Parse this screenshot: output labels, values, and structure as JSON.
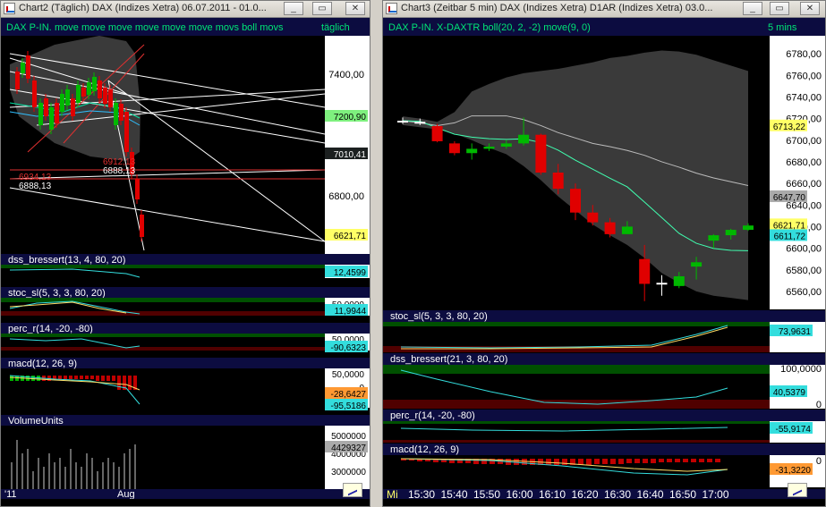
{
  "left_window": {
    "title": "Chart2 (Täglich)  DAX (Indizes Xetra) 06.07.2011 - 01.0...",
    "buttons": [
      "_",
      "▭",
      "✕"
    ],
    "header_label": "DAX P-IN.",
    "header_indicators": "move move move move move move movs boll movs",
    "interval": "täglich",
    "x_labels": [
      "'11",
      "Aug"
    ],
    "panels": [
      {
        "id": "main",
        "ticks": [
          "7400,00",
          "6800,00"
        ],
        "badges": [
          {
            "text": "7200,90",
            "style": "green"
          },
          {
            "text": "7010,41",
            "style": "dark"
          },
          {
            "text": "6621,71",
            "style": "yellow"
          }
        ],
        "annotations": [
          "6934,13",
          "6888,13",
          "6888,13",
          "6912,13"
        ]
      },
      {
        "id": "dss",
        "label": "dss_bressert(13, 4, 80, 20)",
        "ticks": [],
        "badges": [
          {
            "text": "12,4599",
            "style": "cyan"
          }
        ]
      },
      {
        "id": "stoc",
        "label": "stoc_sl(5, 3, 3, 80, 20)",
        "ticks": [
          "50,0000"
        ],
        "badges": [
          {
            "text": "11,9944",
            "style": "cyan"
          }
        ]
      },
      {
        "id": "percr",
        "label": "perc_r(14, -20, -80)",
        "ticks": [
          "50,0000"
        ],
        "badges": [
          {
            "text": "-90,6323",
            "style": "cyan"
          }
        ]
      },
      {
        "id": "macd",
        "label": "macd(12, 26, 9)",
        "ticks": [
          "50,0000",
          "0"
        ],
        "badges": [
          {
            "text": "-28,6427",
            "style": "orange"
          },
          {
            "text": "-95,5186",
            "style": "cyan"
          }
        ]
      },
      {
        "id": "volume",
        "label": "VolumeUnits",
        "ticks": [
          "5000000",
          "4000000",
          "3000000"
        ],
        "badges": [
          {
            "text": "4429327",
            "style": "gray"
          }
        ]
      }
    ]
  },
  "right_window": {
    "title": "Chart3 (Zeitbar 5 min)  DAX (Indizes Xetra) D1AR (Indizes Xetra) 03.0...",
    "buttons": [
      "_",
      "▭",
      "✕"
    ],
    "header_label": "DAX P-IN.",
    "header_indicators": "X-DAXTR boll(20, 2, -2) move(9, 0)",
    "interval": "5 mins",
    "x_labels": [
      "Mi",
      "15:30",
      "15:40",
      "15:50",
      "16:00",
      "16:10",
      "16:20",
      "16:30",
      "16:40",
      "16:50",
      "17:00"
    ],
    "panels": [
      {
        "id": "main",
        "ticks": [
          "6780,00",
          "6760,00",
          "6740,00",
          "6720,00",
          "6700,00",
          "6680,00",
          "6660,00",
          "6640,00",
          "6620,00",
          "6600,00",
          "6580,00",
          "6560,00"
        ],
        "badges": [
          {
            "text": "6713,22",
            "style": "yellow"
          },
          {
            "text": "6647,70",
            "style": "gray"
          },
          {
            "text": "6621,71",
            "style": "yellow"
          },
          {
            "text": "6611,72",
            "style": "cyan"
          }
        ]
      },
      {
        "id": "stoc",
        "label": "stoc_sl(5, 3, 3, 80, 20)",
        "ticks": [],
        "badges": [
          {
            "text": "73,9631",
            "style": "cyan"
          }
        ]
      },
      {
        "id": "dss",
        "label": "dss_bressert(21, 3, 80, 20)",
        "ticks": [
          "100,0000",
          "0"
        ],
        "badges": [
          {
            "text": "40,5379",
            "style": "cyan"
          }
        ]
      },
      {
        "id": "percr",
        "label": "perc_r(14, -20, -80)",
        "ticks": [],
        "badges": [
          {
            "text": "-55,9174",
            "style": "cyan"
          }
        ]
      },
      {
        "id": "macd",
        "label": "macd(12, 26, 9)",
        "ticks": [
          "0"
        ],
        "badges": [
          {
            "text": "-31,3220",
            "style": "orange"
          }
        ]
      }
    ]
  },
  "colors": {
    "up": "#00b800",
    "down": "#e00000",
    "band": "#3a3a3a",
    "zone_hi": "#005000",
    "zone_lo": "#500000",
    "axis_bg": "#ffffff",
    "header": "#00e676"
  },
  "chart_data": [
    {
      "type": "candlestick",
      "title": "DAX (Indizes Xetra)",
      "interval": "5 mins",
      "x": [
        "15:20",
        "15:25",
        "15:30",
        "15:35",
        "15:40",
        "15:45",
        "15:50",
        "15:55",
        "16:00",
        "16:05",
        "16:10",
        "16:15",
        "16:20",
        "16:25",
        "16:30",
        "16:35",
        "16:40",
        "16:45",
        "16:50",
        "16:55",
        "17:00"
      ],
      "open": [
        6718,
        6717,
        6713,
        6697,
        6688,
        6692,
        6694,
        6697,
        6705,
        6670,
        6655,
        6633,
        6624,
        6613,
        6590,
        6568,
        6565,
        6583,
        6607,
        6612,
        6617
      ],
      "close": [
        6718,
        6717,
        6699,
        6688,
        6692,
        6694,
        6697,
        6705,
        6670,
        6655,
        6633,
        6624,
        6613,
        6620,
        6567,
        6568,
        6574,
        6587,
        6612,
        6617,
        6621
      ],
      "high": [
        6721,
        6720,
        6715,
        6699,
        6697,
        6697,
        6700,
        6721,
        6706,
        6678,
        6660,
        6640,
        6628,
        6625,
        6603,
        6575,
        6578,
        6592,
        6613,
        6618,
        6623
      ],
      "low": [
        6715,
        6714,
        6698,
        6686,
        6682,
        6690,
        6692,
        6695,
        6668,
        6650,
        6626,
        6621,
        6610,
        6614,
        6551,
        6556,
        6563,
        6571,
        6600,
        6608,
        6616
      ],
      "bollinger_upper": [
        6722,
        6720,
        6717,
        6726,
        6745,
        6752,
        6758,
        6762,
        6764,
        6766,
        6769,
        6772,
        6776,
        6778,
        6781,
        6783,
        6782,
        6779,
        6774,
        6769,
        6764
      ],
      "bollinger_lower": [
        6714,
        6712,
        6710,
        6706,
        6700,
        6693,
        6687,
        6676,
        6663,
        6648,
        6635,
        6622,
        6612,
        6603,
        6591,
        6577,
        6568,
        6560,
        6556,
        6554,
        6552
      ],
      "ylim": [
        6550,
        6790
      ]
    }
  ]
}
